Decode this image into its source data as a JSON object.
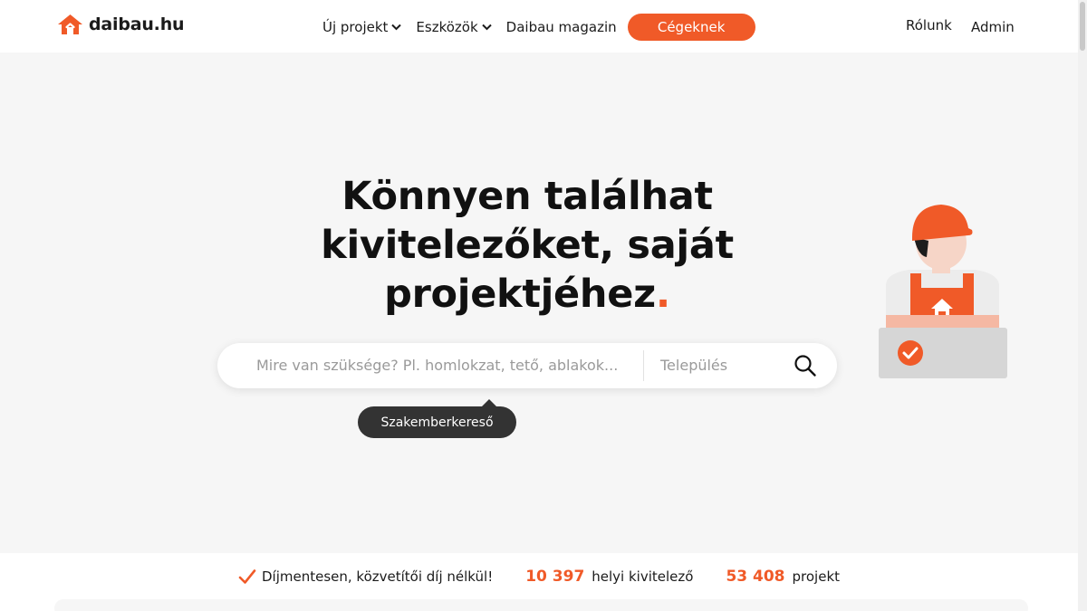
{
  "brand": {
    "name": "daibau.hu",
    "accent": "#f05a28"
  },
  "nav": {
    "items": [
      {
        "label": "Új projekt",
        "has_dropdown": true
      },
      {
        "label": "Eszközök",
        "has_dropdown": true
      },
      {
        "label": "Daibau magazin",
        "has_dropdown": false
      }
    ],
    "cta_label": "Cégeknek",
    "about_label": "Rólunk",
    "admin_label": "Admin"
  },
  "hero": {
    "title_line1": "Könnyen találhat",
    "title_line2": "kivitelezőket, saját",
    "title_line3": "projektjéhez",
    "title_dot": "."
  },
  "search": {
    "query_placeholder": "Mire van szüksége? Pl. homlokzat, tető, ablakok...",
    "location_placeholder": "Település",
    "tooltip": "Szakemberkereső",
    "icons": {
      "search": "search-icon"
    }
  },
  "stats": {
    "free_text": "Díjmentesen, közvetítői díj nélkül!",
    "contractors_count": "10 397",
    "contractors_label": "helyi kivitelező",
    "projects_count": "53 408",
    "projects_label": "projekt"
  }
}
